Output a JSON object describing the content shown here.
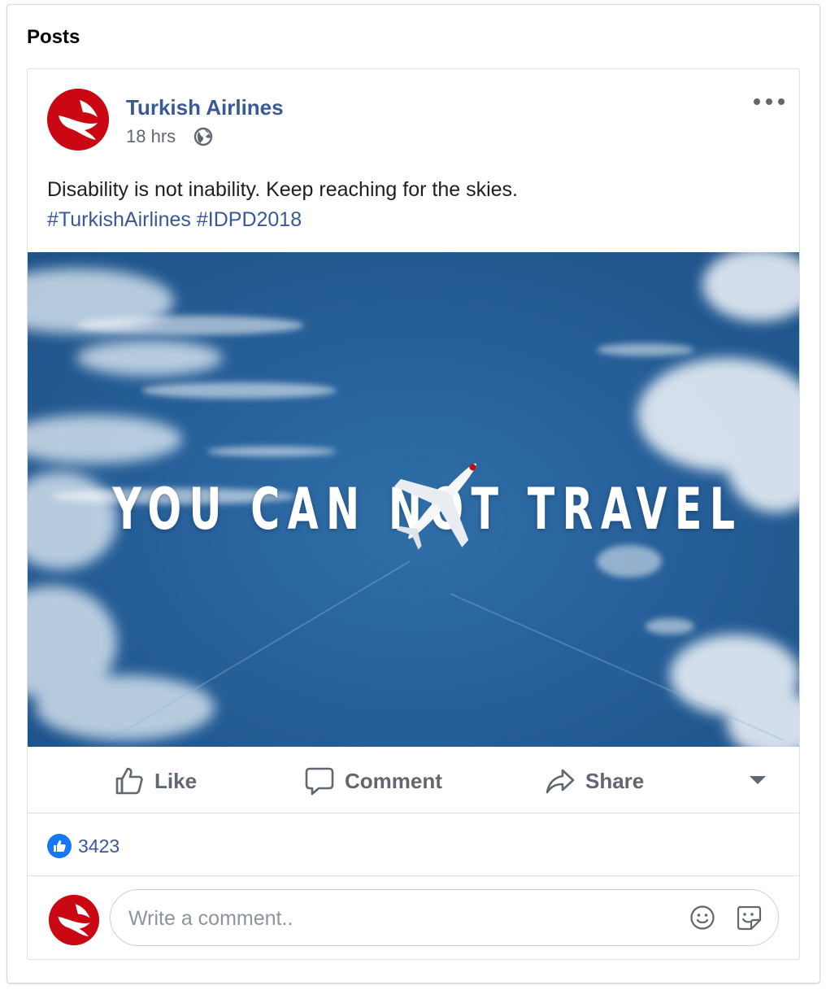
{
  "section": {
    "title": "Posts"
  },
  "post": {
    "page_name": "Turkish Airlines",
    "timestamp": "18 hrs",
    "audience_icon": "globe-icon",
    "more_icon": "more-options-icon",
    "text": "Disability is not inability. Keep reaching for the skies.",
    "hashtags": [
      "#TurkishAirlines",
      "#IDPD2018"
    ],
    "image": {
      "headline": "YOU CAN NOT TRAVEL",
      "description_icon": "airplane-icon"
    },
    "actions": {
      "like": "Like",
      "comment": "Comment",
      "share": "Share"
    },
    "reactions": {
      "icon": "like-reaction-icon",
      "count": "3423"
    },
    "comment_box": {
      "placeholder": "Write a comment..",
      "emoji_icon": "emoji-icon",
      "sticker_icon": "sticker-icon"
    }
  },
  "colors": {
    "brand_red": "#c90813",
    "link_blue": "#385898",
    "like_blue": "#1877f2",
    "muted": "#606770"
  }
}
